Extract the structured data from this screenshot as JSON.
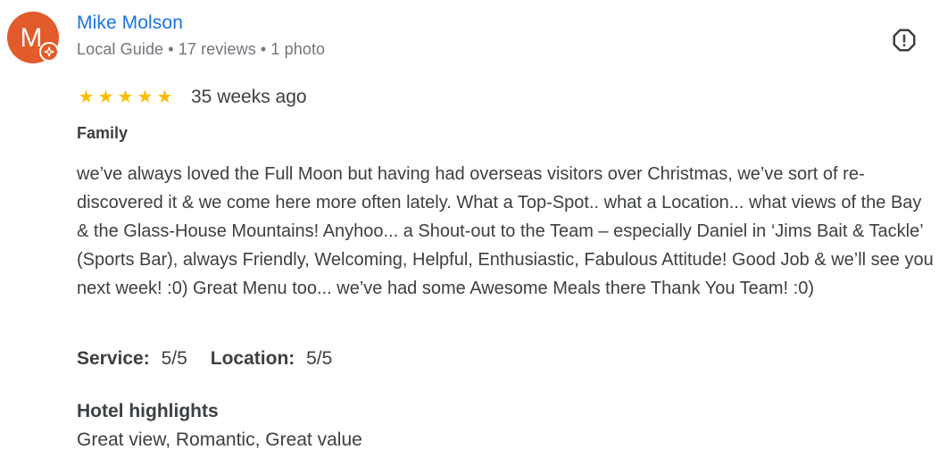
{
  "reviewer": {
    "avatar_initial": "M",
    "avatar_color": "#e25b2a",
    "name": "Mike Molson",
    "meta": "Local Guide • 17 reviews • 1 photo",
    "badge_icon": "local-guide-star-icon"
  },
  "report_icon": "report-icon",
  "rating": {
    "stars": 5,
    "max_stars": 5,
    "time_ago": "35 weeks ago"
  },
  "trip_type": "Family",
  "review_text": "we’ve always loved the Full Moon but having had overseas visitors over Christmas, we’ve sort of re-discovered it & we come here more often lately. What a Top-Spot.. what a Location... what views of the Bay & the Glass-House Mountains! Anyhoo... a Shout-out to the Team – especially Daniel in ‘Jims Bait & Tackle’ (Sports Bar), always Friendly, Welcoming, Helpful, Enthusiastic, Fabulous Attitude! Good Job & we’ll see you next week! :0) Great Menu too... we’ve had some Awesome Meals there Thank You Team! :0)",
  "sub_ratings": [
    {
      "label": "Service:",
      "value": "5/5"
    },
    {
      "label": "Location:",
      "value": "5/5"
    }
  ],
  "highlights": {
    "title": "Hotel highlights",
    "text": "Great view, Romantic, Great value"
  },
  "colors": {
    "name_link": "#1a73e8",
    "star": "#fbbc04",
    "text": "#3c4043",
    "muted": "#70757a"
  }
}
